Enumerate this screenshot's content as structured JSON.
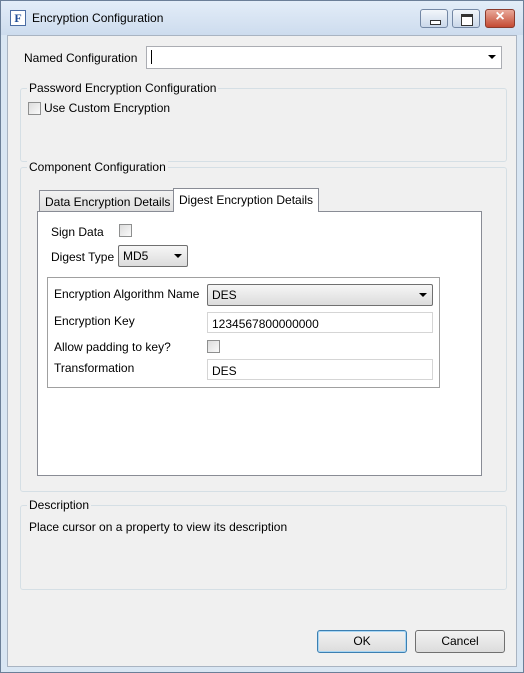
{
  "window": {
    "title": "Encryption Configuration",
    "icon_letter": "F"
  },
  "named_configuration": {
    "label": "Named Configuration",
    "value": ""
  },
  "password_group": {
    "title": "Password Encryption Configuration",
    "use_custom_label": "Use Custom Encryption",
    "use_custom_checked": false
  },
  "component_group": {
    "title": "Component Configuration",
    "tabs": [
      {
        "label": "Data Encryption Details",
        "active": false
      },
      {
        "label": "Digest Encryption Details",
        "active": true
      }
    ],
    "sign_data_label": "Sign Data",
    "sign_data_checked": false,
    "digest_type_label": "Digest Type",
    "digest_type_value": "MD5",
    "algorithm_label": "Encryption Algorithm Name",
    "algorithm_value": "DES",
    "key_label": "Encryption Key",
    "key_value": "1234567800000000",
    "padding_label": "Allow padding to key?",
    "padding_checked": false,
    "transformation_label": "Transformation",
    "transformation_value": "DES"
  },
  "description": {
    "title": "Description",
    "text": "Place cursor on a property to view its description"
  },
  "buttons": {
    "ok": "OK",
    "cancel": "Cancel"
  }
}
